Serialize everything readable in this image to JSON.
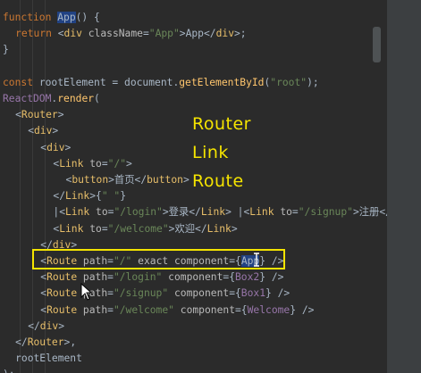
{
  "overlay": {
    "labels": [
      "Router",
      "Link",
      "Route"
    ]
  },
  "code": {
    "lines": [
      {
        "indent": 0,
        "tokens": [
          [
            "kw",
            "function "
          ],
          [
            "sel",
            "App"
          ],
          [
            "txt",
            "() {"
          ]
        ]
      },
      {
        "indent": 2,
        "tokens": [
          [
            "kw",
            "return "
          ],
          [
            "txt",
            "<"
          ],
          [
            "tag",
            "div "
          ],
          [
            "attr",
            "className"
          ],
          [
            "txt",
            "="
          ],
          [
            "str",
            "\"App\""
          ],
          [
            "txt",
            ">App</"
          ],
          [
            "tag",
            "div"
          ],
          [
            "txt",
            ">;"
          ]
        ]
      },
      {
        "indent": 0,
        "tokens": [
          [
            "txt",
            "}"
          ]
        ]
      },
      {
        "indent": 0,
        "tokens": []
      },
      {
        "indent": 0,
        "tokens": [
          [
            "kw",
            "const "
          ],
          [
            "txt",
            "rootElement = document."
          ],
          [
            "fn",
            "getElementById"
          ],
          [
            "txt",
            "("
          ],
          [
            "str",
            "\"root\""
          ],
          [
            "txt",
            ");"
          ]
        ]
      },
      {
        "indent": 0,
        "tokens": [
          [
            "prop",
            "ReactDOM"
          ],
          [
            "txt",
            "."
          ],
          [
            "fn",
            "render"
          ],
          [
            "txt",
            "("
          ]
        ]
      },
      {
        "indent": 2,
        "tokens": [
          [
            "txt",
            "<"
          ],
          [
            "tag",
            "Router"
          ],
          [
            "txt",
            ">"
          ]
        ]
      },
      {
        "indent": 4,
        "tokens": [
          [
            "txt",
            "<"
          ],
          [
            "tag",
            "div"
          ],
          [
            "txt",
            ">"
          ]
        ]
      },
      {
        "indent": 6,
        "tokens": [
          [
            "txt",
            "<"
          ],
          [
            "tag",
            "div"
          ],
          [
            "txt",
            ">"
          ]
        ]
      },
      {
        "indent": 8,
        "tokens": [
          [
            "txt",
            "<"
          ],
          [
            "tag",
            "Link "
          ],
          [
            "attr",
            "to"
          ],
          [
            "txt",
            "="
          ],
          [
            "str",
            "\"/\""
          ],
          [
            "txt",
            ">"
          ]
        ]
      },
      {
        "indent": 10,
        "tokens": [
          [
            "txt",
            "<"
          ],
          [
            "tag",
            "button"
          ],
          [
            "txt",
            ">首页</"
          ],
          [
            "tag",
            "button"
          ],
          [
            "txt",
            ">"
          ]
        ]
      },
      {
        "indent": 8,
        "tokens": [
          [
            "txt",
            "</"
          ],
          [
            "tag",
            "Link"
          ],
          [
            "txt",
            ">{"
          ],
          [
            "str",
            "\" \""
          ],
          [
            "txt",
            "}"
          ]
        ]
      },
      {
        "indent": 8,
        "tokens": [
          [
            "txt",
            "|<"
          ],
          [
            "tag",
            "Link "
          ],
          [
            "attr",
            "to"
          ],
          [
            "txt",
            "="
          ],
          [
            "str",
            "\"/login\""
          ],
          [
            "txt",
            ">登录</"
          ],
          [
            "tag",
            "Link"
          ],
          [
            "txt",
            "> |<"
          ],
          [
            "tag",
            "Link "
          ],
          [
            "attr",
            "to"
          ],
          [
            "txt",
            "="
          ],
          [
            "str",
            "\"/signup\""
          ],
          [
            "txt",
            ">注册</L"
          ]
        ]
      },
      {
        "indent": 8,
        "tokens": [
          [
            "txt",
            "<"
          ],
          [
            "tag",
            "Link "
          ],
          [
            "attr",
            "to"
          ],
          [
            "txt",
            "="
          ],
          [
            "str",
            "\"/welcome\""
          ],
          [
            "txt",
            ">欢迎</"
          ],
          [
            "tag",
            "Link"
          ],
          [
            "txt",
            ">"
          ]
        ]
      },
      {
        "indent": 6,
        "tokens": [
          [
            "txt",
            "</"
          ],
          [
            "tag",
            "div"
          ],
          [
            "txt",
            ">"
          ]
        ]
      },
      {
        "indent": 6,
        "tokens": [
          [
            "txt",
            "<"
          ],
          [
            "tag",
            "Route "
          ],
          [
            "attr",
            "path"
          ],
          [
            "txt",
            "="
          ],
          [
            "str",
            "\"/\" "
          ],
          [
            "attr",
            "exact component"
          ],
          [
            "txt",
            "={"
          ],
          [
            "sel",
            "App"
          ],
          [
            "txt",
            "} />"
          ]
        ]
      },
      {
        "indent": 6,
        "tokens": [
          [
            "txt",
            "<"
          ],
          [
            "tag",
            "Route "
          ],
          [
            "attr",
            "path"
          ],
          [
            "txt",
            "="
          ],
          [
            "str",
            "\"/login\" "
          ],
          [
            "attr",
            "component"
          ],
          [
            "txt",
            "={"
          ],
          [
            "jsx",
            "Box2"
          ],
          [
            "txt",
            "} />"
          ]
        ]
      },
      {
        "indent": 6,
        "tokens": [
          [
            "txt",
            "<"
          ],
          [
            "tag",
            "Route "
          ],
          [
            "attr",
            "path"
          ],
          [
            "txt",
            "="
          ],
          [
            "str",
            "\"/signup\" "
          ],
          [
            "attr",
            "component"
          ],
          [
            "txt",
            "={"
          ],
          [
            "jsx",
            "Box1"
          ],
          [
            "txt",
            "} />"
          ]
        ]
      },
      {
        "indent": 6,
        "tokens": [
          [
            "txt",
            "<"
          ],
          [
            "tag",
            "Route "
          ],
          [
            "attr",
            "path"
          ],
          [
            "txt",
            "="
          ],
          [
            "str",
            "\"/welcome\" "
          ],
          [
            "attr",
            "component"
          ],
          [
            "txt",
            "={"
          ],
          [
            "jsx",
            "Welcome"
          ],
          [
            "txt",
            "} />"
          ]
        ]
      },
      {
        "indent": 4,
        "tokens": [
          [
            "txt",
            "</"
          ],
          [
            "tag",
            "div"
          ],
          [
            "txt",
            ">"
          ]
        ]
      },
      {
        "indent": 2,
        "tokens": [
          [
            "txt",
            "</"
          ],
          [
            "tag",
            "Router"
          ],
          [
            "txt",
            ">,"
          ]
        ]
      },
      {
        "indent": 2,
        "tokens": [
          [
            "txt",
            "rootElement"
          ]
        ]
      },
      {
        "indent": 0,
        "tokens": [
          [
            "txt",
            ");"
          ]
        ]
      }
    ]
  },
  "colors": {
    "highlight_box": "#f4e400",
    "overlay_text": "#f5e400",
    "background": "#2b2b2b"
  }
}
